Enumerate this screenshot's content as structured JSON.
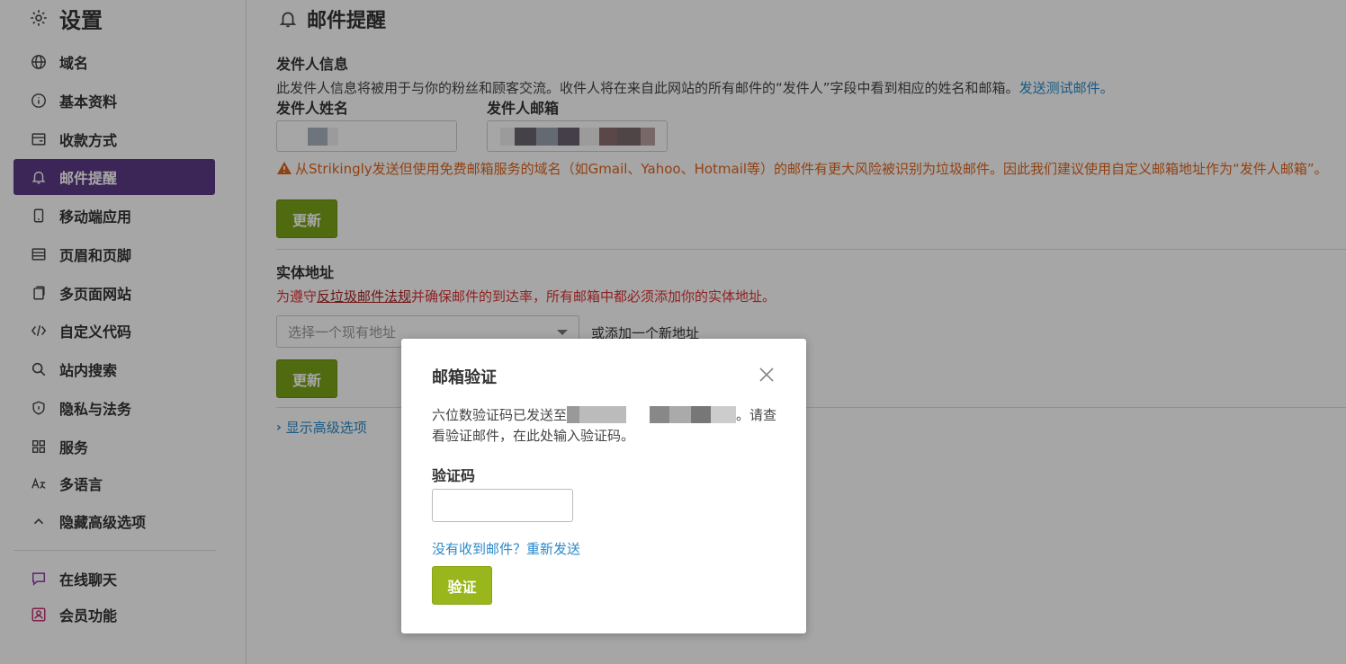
{
  "sidebar": {
    "title": "设置",
    "items": [
      {
        "label": "域名",
        "icon": "globe-icon"
      },
      {
        "label": "基本资料",
        "icon": "info-icon"
      },
      {
        "label": "收款方式",
        "icon": "wallet-icon"
      },
      {
        "label": "邮件提醒",
        "icon": "bell-icon",
        "active": true
      },
      {
        "label": "移动端应用",
        "icon": "mobile-icon"
      },
      {
        "label": "页眉和页脚",
        "icon": "layout-icon"
      },
      {
        "label": "多页面网站",
        "icon": "pages-icon"
      },
      {
        "label": "自定义代码",
        "icon": "code-icon"
      },
      {
        "label": "站内搜索",
        "icon": "search-icon"
      },
      {
        "label": "隐私与法务",
        "icon": "shield-icon"
      },
      {
        "label": "服务",
        "icon": "grid-icon"
      },
      {
        "label": "多语言",
        "icon": "translate-icon"
      },
      {
        "label": "隐藏高级选项",
        "icon": "chevron-up-icon"
      }
    ],
    "bottom_items": [
      {
        "label": "在线聊天",
        "icon": "chat-icon"
      },
      {
        "label": "会员功能",
        "icon": "member-icon"
      }
    ],
    "colors": {
      "active_bg": "#5c3a86"
    }
  },
  "main": {
    "title": "邮件提醒",
    "sender": {
      "section_title": "发件人信息",
      "description": "此发件人信息将被用于与你的粉丝和顾客交流。收件人将在来自此网站的所有邮件的“发件人”字段中看到相应的姓名和邮箱。",
      "test_link": "发送测试邮件。",
      "name_label": "发件人姓名",
      "email_label": "发件人邮箱",
      "warning": "从Strikingly发送但使用免费邮箱服务的域名（如Gmail、Yahoo、Hotmail等）的邮件有更大风险被识别为垃圾邮件。因此我们建议使用自定义邮箱地址作为“发件人邮箱”。",
      "update_button": "更新"
    },
    "address": {
      "section_title": "实体地址",
      "desc_prefix": "为遵守",
      "desc_law": "反垃圾邮件法规",
      "desc_suffix": "并确保邮件的到达率，所有邮箱中都必须添加你的实体地址。",
      "select_placeholder": "选择一个现有地址",
      "add_link": "或添加一个新地址",
      "update_button": "更新"
    },
    "advanced_link": "显示高级选项"
  },
  "modal": {
    "title": "邮箱验证",
    "text_prefix": "六位数验证码已发送至",
    "text_suffix": "。请查看验证邮件，在此处输入验证码。",
    "code_label": "验证码",
    "code_value": "",
    "resend_question": "没有收到邮件？",
    "resend_link": "重新发送",
    "verify_button": "验证"
  },
  "colors": {
    "accent_green": "#7ba317",
    "verify_green": "#99b71c",
    "link_blue": "#2a8ac9",
    "warning_orange": "#e0641b",
    "error_red": "#d33"
  }
}
